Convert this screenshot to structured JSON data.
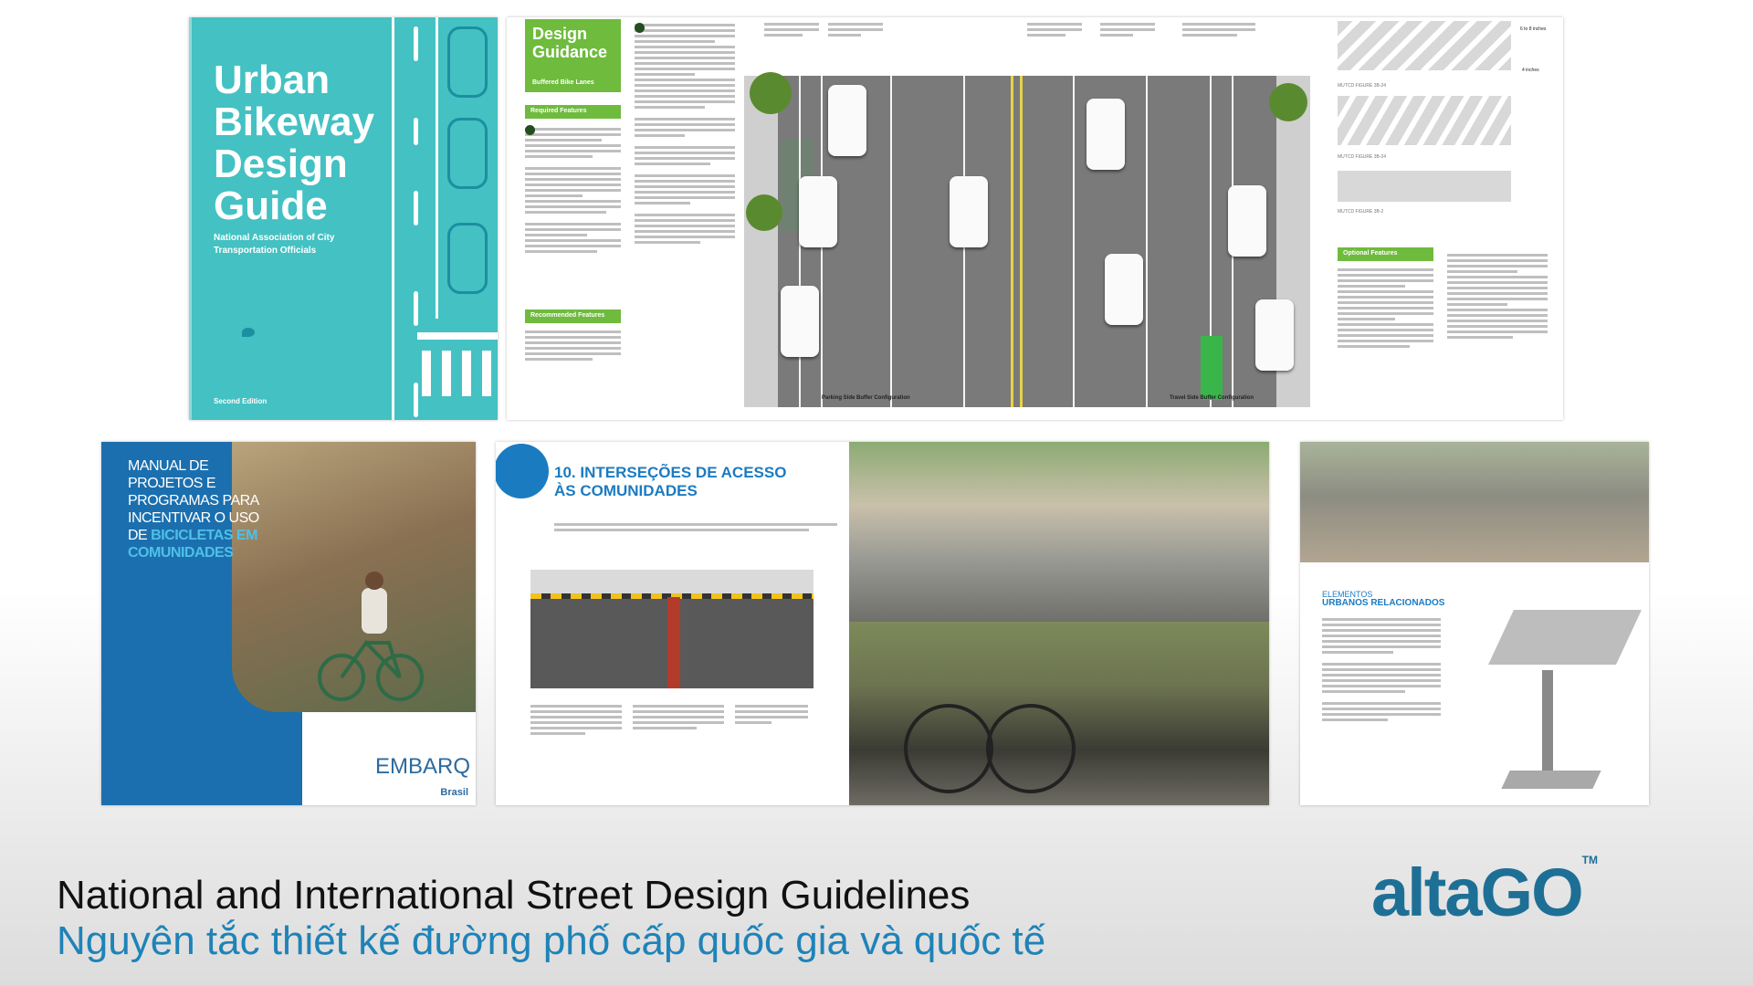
{
  "cover_urban": {
    "title": "Urban\nBikeway\nDesign\nGuide",
    "org": "National Association of City Transportation Officials",
    "edition": "Second Edition"
  },
  "guidance": {
    "title": "Design\nGuidance",
    "subtitle": "Buffered Bike Lanes",
    "required": "Required Features",
    "recommended": "Recommended Features",
    "optional": "Optional Features",
    "caption_left": "Parking Side Buffer Configuration",
    "caption_right": "Travel Side Buffer Configuration",
    "figure_a": "MUTCD FIGURE 3B-24",
    "figure_b": "MUTCD FIGURE 3B-24",
    "figure_c": "MUTCD FIGURE 3B-2",
    "dim_a": "6 to 8 inches",
    "dim_b": "4 inches"
  },
  "cover_embarq": {
    "title_l1": "MANUAL DE",
    "title_l2": "PROJETOS E",
    "title_l3": "PROGRAMAS PARA",
    "title_l4": "INCENTIVAR O USO",
    "title_l5a": "DE ",
    "title_l5b": "BICICLETAS EM",
    "title_l6": "COMUNIDADES",
    "logo": "EMBARQ",
    "logo_sub": "Brasil"
  },
  "spread": {
    "heading": "10. INTERSEÇÕES DE ACESSO\nÀS COMUNIDADES"
  },
  "page3": {
    "kicker": "ELEMENTOS",
    "heading": "URBANOS RELACIONADOS"
  },
  "footer": {
    "title_en": "National and International Street Design Guidelines",
    "title_vi": "Nguyên tắc thiết kế đường phố cấp quốc gia và quốc tế",
    "brand": "altaGO",
    "brand_tm": "TM"
  },
  "colors": {
    "teal_cover": "#44c1c2",
    "guidance_green": "#6fbb3d",
    "embarq_blue": "#1b6fae",
    "heading_blue": "#1b7bc1",
    "brand_blue": "#1e6f96"
  }
}
